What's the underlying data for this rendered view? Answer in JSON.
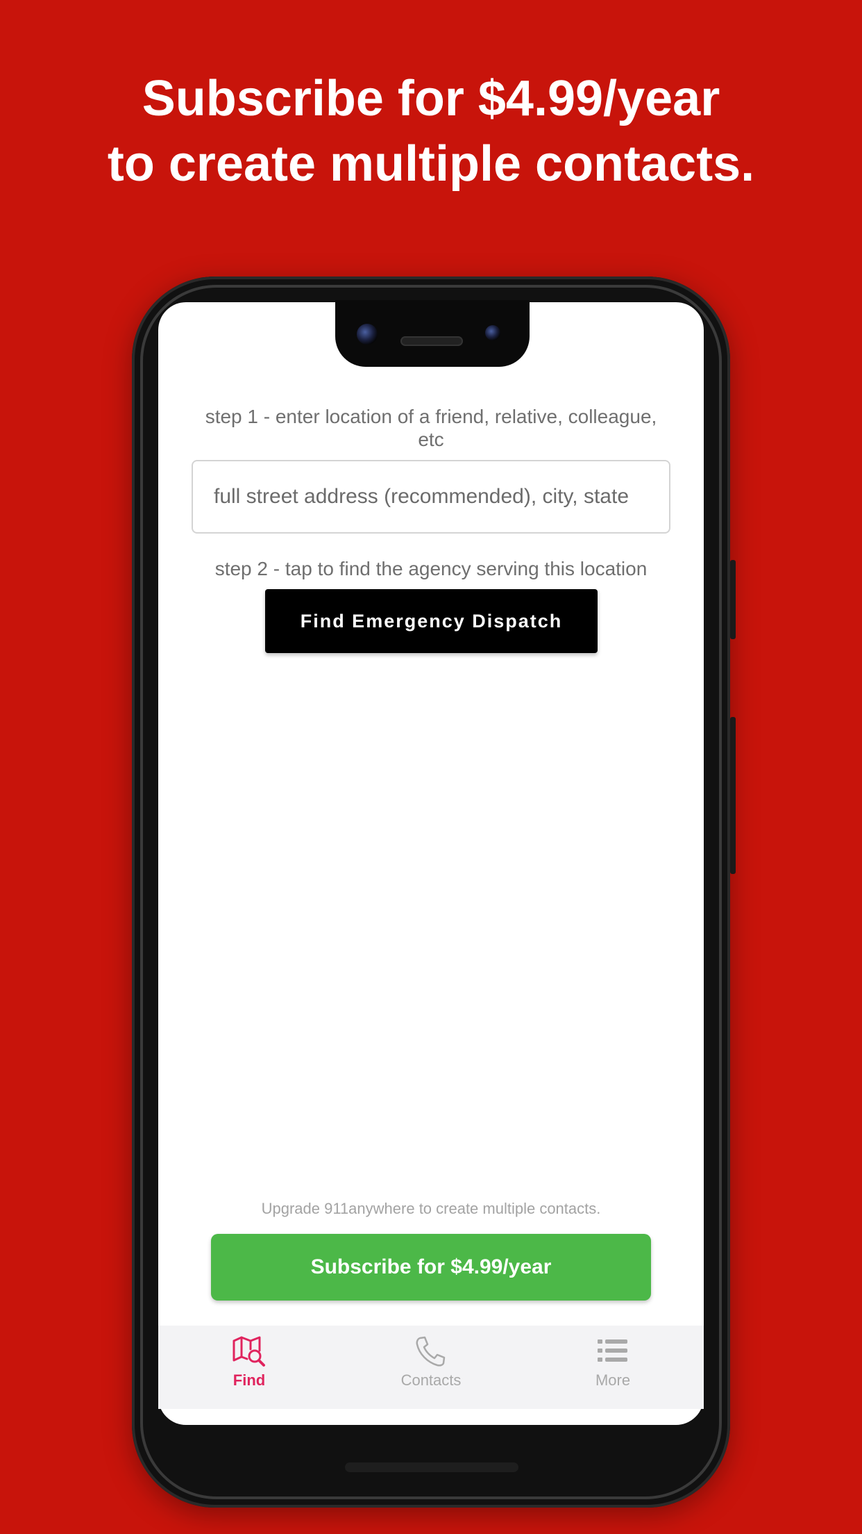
{
  "headline": {
    "line1": "Subscribe for $4.99/year",
    "line2": "to create multiple contacts."
  },
  "find": {
    "step1_label": "step 1 - enter location of a friend, relative, colleague, etc",
    "address_placeholder": "full street address (recommended), city, state",
    "address_value": "",
    "step2_label": "step 2 - tap to find the agency serving this location",
    "find_button_label": "Find Emergency Dispatch"
  },
  "upgrade": {
    "message": "Upgrade 911anywhere to create multiple contacts.",
    "subscribe_label": "Subscribe for $4.99/year"
  },
  "tabs": [
    {
      "label": "Find",
      "icon": "map-search-icon",
      "active": true
    },
    {
      "label": "Contacts",
      "icon": "phone-icon",
      "active": false
    },
    {
      "label": "More",
      "icon": "list-icon",
      "active": false
    }
  ],
  "colors": {
    "background": "#c8140b",
    "accent_active": "#e0245e",
    "subscribe_green": "#4cb848",
    "button_black": "#000000"
  }
}
